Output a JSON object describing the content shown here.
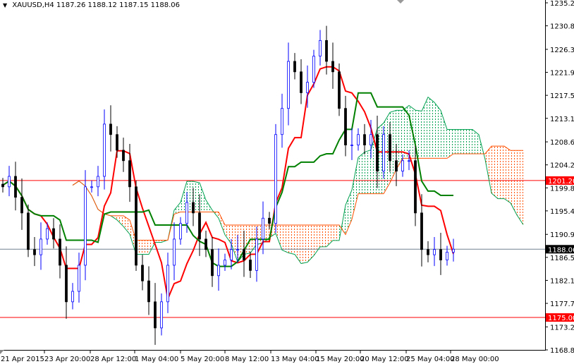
{
  "header": {
    "symbol": "XAUUSD,H4",
    "open": "1187.26",
    "high": "1188.12",
    "low": "1187.15",
    "close": "1188.06"
  },
  "colors": {
    "up": "#0000ff",
    "down": "#000000",
    "tenkan": "#ff0000",
    "kijun": "#008000",
    "cloud_bull": "#00a050",
    "cloud_bear": "#ff5000",
    "level": "#ff0000",
    "price_line": "#708090"
  },
  "chart_data": {
    "type": "candlestick",
    "title": "XAUUSD,H4",
    "ylim": [
      1168.8,
      1235.2
    ],
    "y_ticks": [
      "1235.20",
      "1230.80",
      "1226.30",
      "1221.90",
      "1217.50",
      "1213.10",
      "1208.60",
      "1204.20",
      "1199.80",
      "1195.40",
      "1190.90",
      "1186.50",
      "1182.10",
      "1177.70",
      "1173.20",
      "1168.80"
    ],
    "x_labels": [
      "21 Apr 2015",
      "23 Apr 20:00",
      "28 Apr 12:00",
      "1 May 04:00",
      "5 May 20:00",
      "8 May 12:00",
      "13 May 04:00",
      "15 May 20:00",
      "20 May 12:00",
      "25 May 04:00",
      "28 May 00:00"
    ],
    "closes": [
      1200,
      1202,
      1198,
      1195,
      1188,
      1187,
      1190,
      1192,
      1190,
      1185,
      1178,
      1180,
      1185,
      1200,
      1200,
      1202,
      1212,
      1210,
      1207,
      1205,
      1200,
      1185,
      1182,
      1178,
      1173,
      1178,
      1185,
      1190,
      1193,
      1197,
      1195,
      1190,
      1188,
      1183,
      1185,
      1186,
      1188,
      1188,
      1186,
      1184,
      1190,
      1194,
      1193,
      1210,
      1215,
      1224,
      1222,
      1218,
      1220,
      1225,
      1228,
      1224,
      1222,
      1215,
      1208,
      1208,
      1210,
      1208,
      1210,
      1203,
      1210,
      1205,
      1203,
      1205,
      1205,
      1195,
      1188,
      1187,
      1188,
      1186,
      1187.5,
      1188.06
    ],
    "levels": [
      {
        "label": "1201.20",
        "value": 1201.2,
        "color": "#ff0000"
      },
      {
        "label": "1175.00",
        "value": 1175.0,
        "color": "#ff0000"
      },
      {
        "label": "1188.06",
        "value": 1188.06,
        "color": "#000000"
      }
    ],
    "indicator": "Ichimoku Kinko Hyo"
  }
}
